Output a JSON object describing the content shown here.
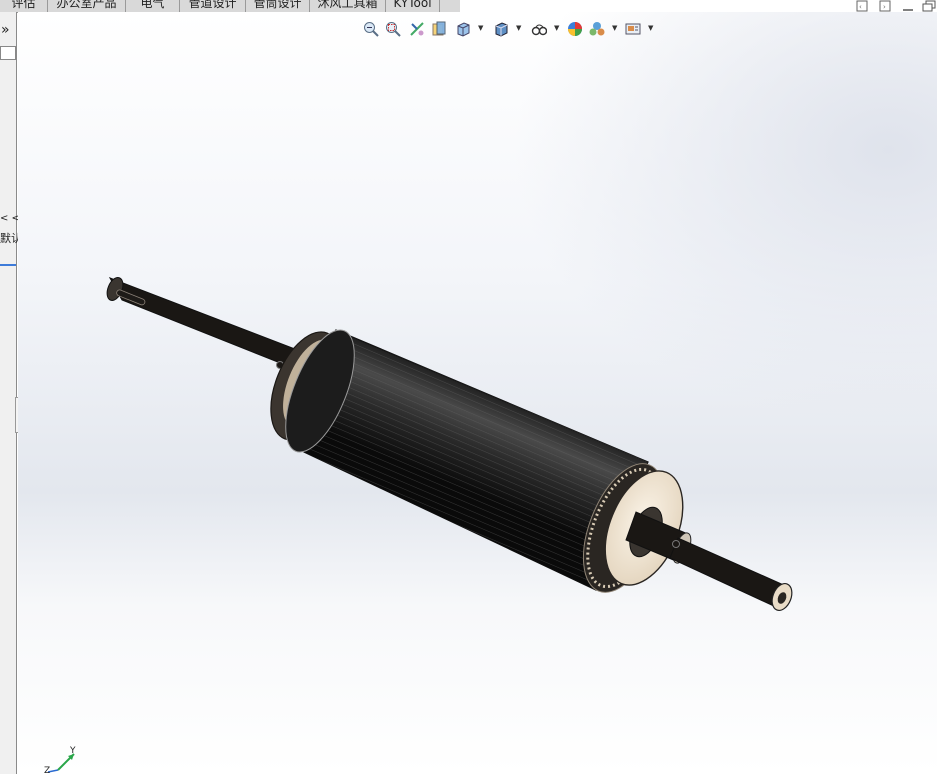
{
  "command_tabs": [
    "评估",
    "办公室产品",
    "电气",
    "管道设计",
    "管筒设计",
    "沐风工具箱",
    "KYTool"
  ],
  "left_panel": {
    "expand_glyph": "»",
    "breadcrumb_text": "< <",
    "label_text": "默认"
  },
  "window_controls": [
    "restore-icon",
    "restore-icon",
    "minimize-icon",
    "restore-window-icon"
  ],
  "view_toolbar": {
    "icons": [
      "zoom-to-fit-icon",
      "zoom-to-area-icon",
      "previous-view-icon",
      "section-view-icon",
      "view-orientation-icon",
      "display-style-icon",
      "hide-show-items-icon",
      "edit-appearance-icon",
      "apply-scene-icon",
      "view-settings-icon"
    ]
  },
  "triad": {
    "y_label": "Y",
    "z_label": "Z"
  },
  "colors": {
    "roller": "#1c1c1c",
    "shaft": "#3a3530",
    "flange": "#efe4d2",
    "viewport_top": "#ffffff",
    "viewport_mid": "#e3e7ee"
  }
}
